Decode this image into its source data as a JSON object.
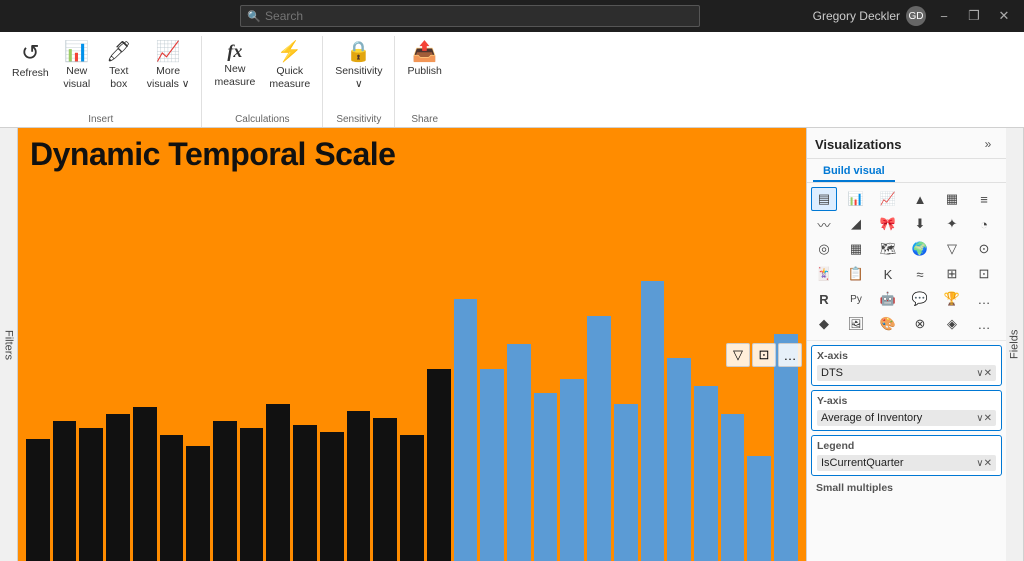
{
  "titleBar": {
    "searchPlaceholder": "Search",
    "userName": "Gregory Deckler",
    "minimizeLabel": "−",
    "restoreLabel": "❐",
    "closeLabel": "✕"
  },
  "ribbon": {
    "groups": [
      {
        "id": "insert",
        "label": "Insert",
        "items": [
          {
            "id": "refresh",
            "icon": "↺",
            "label": "Refresh"
          },
          {
            "id": "new-visual",
            "icon": "📊",
            "label": "New\nvisual"
          },
          {
            "id": "text-box",
            "icon": "🖊",
            "label": "Text\nbox"
          },
          {
            "id": "more-visuals",
            "icon": "📈",
            "label": "More\nvisuals ∨"
          }
        ]
      },
      {
        "id": "calculations",
        "label": "Calculations",
        "items": [
          {
            "id": "new-measure",
            "icon": "fx",
            "label": "New\nmeasure"
          },
          {
            "id": "quick-measure",
            "icon": "⚡",
            "label": "Quick\nmeasure"
          }
        ]
      },
      {
        "id": "sensitivity",
        "label": "Sensitivity",
        "items": [
          {
            "id": "sensitivity-btn",
            "icon": "🔒",
            "label": "Sensitivity\n∨"
          }
        ]
      },
      {
        "id": "share",
        "label": "Share",
        "items": [
          {
            "id": "publish",
            "icon": "📤",
            "label": "Publish"
          }
        ]
      }
    ]
  },
  "canvas": {
    "title": "Dynamic Temporal Scale",
    "filterIcon": "▽",
    "focusIcon": "⊡",
    "moreIcon": "…"
  },
  "filters": {
    "label": "Filters"
  },
  "vizPanel": {
    "title": "Visualizations",
    "expandIcon": "»",
    "fieldsLabel": "Fields",
    "buildVisualTab": "Build visual",
    "dataFields": [
      {
        "id": "x-axis",
        "label": "X-axis",
        "value": "DTS"
      },
      {
        "id": "y-axis",
        "label": "Y-axis",
        "value": "Average of Inventory"
      },
      {
        "id": "legend",
        "label": "Legend",
        "value": "IsCurrentQuarter"
      },
      {
        "id": "small-multiples",
        "label": "Small multiples",
        "value": ""
      }
    ]
  },
  "bars": {
    "black": [
      35,
      40,
      38,
      42,
      44,
      36,
      33,
      40,
      38,
      45,
      39,
      37,
      43,
      41,
      36,
      55
    ],
    "blue": [
      75,
      55,
      62,
      48,
      52,
      70,
      45,
      80,
      58,
      50,
      42,
      30,
      65
    ],
    "chartHeight": 380
  }
}
